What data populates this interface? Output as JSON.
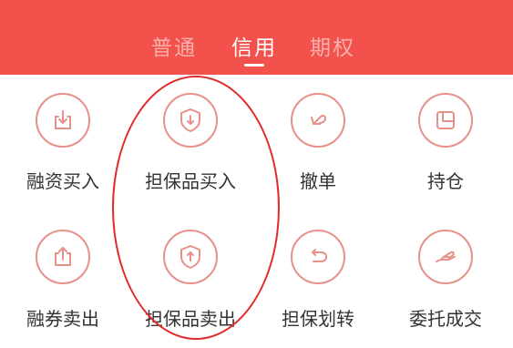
{
  "tabs": [
    {
      "label": "普通",
      "active": false
    },
    {
      "label": "信用",
      "active": true
    },
    {
      "label": "期权",
      "active": false
    }
  ],
  "grid": [
    {
      "label": "融资买入",
      "icon": "download-box-icon"
    },
    {
      "label": "担保品买入",
      "icon": "shield-down-icon"
    },
    {
      "label": "撤单",
      "icon": "undo-arrow-icon"
    },
    {
      "label": "持仓",
      "icon": "portfolio-icon"
    },
    {
      "label": "融券卖出",
      "icon": "upload-box-icon"
    },
    {
      "label": "担保品卖出",
      "icon": "shield-up-icon"
    },
    {
      "label": "担保划转",
      "icon": "transfer-arrow-icon"
    },
    {
      "label": "委托成交",
      "icon": "handshake-icon"
    }
  ],
  "colors": {
    "header": "#f2524b",
    "tab_inactive": "#f9b0ac",
    "icon_stroke": "#e7908a",
    "annotation_oval": "#e12b2b"
  }
}
